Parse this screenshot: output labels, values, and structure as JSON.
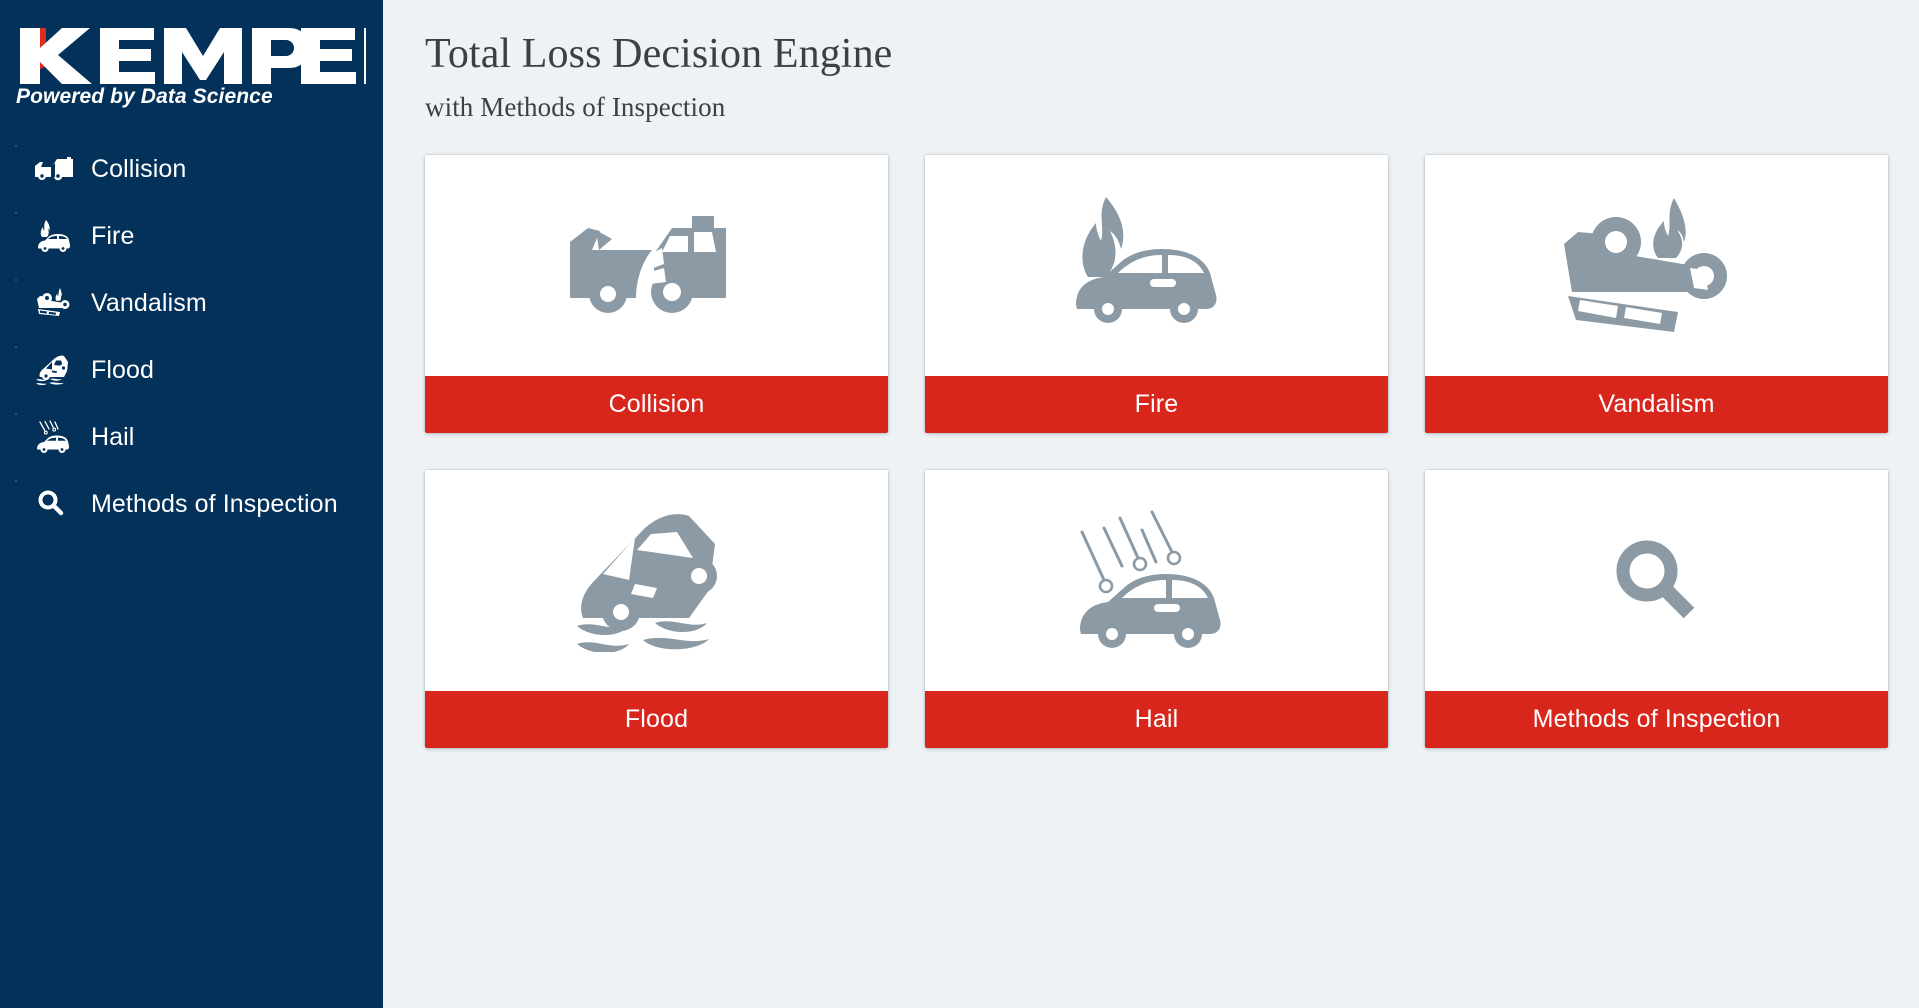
{
  "brand": {
    "logo_text": "KEMPER",
    "tagline": "Powered by Data Science",
    "navy": "#033159",
    "red": "#d9261c",
    "logo_accent_red": "#e02b1b"
  },
  "theme": {
    "page_background": "#eff2f5",
    "card_background": "#ffffff",
    "band_red": "#d9261c",
    "icon_gray": "#8b9aa4",
    "title_color": "#3b4045"
  },
  "sidebar": {
    "items": [
      {
        "label": "Collision",
        "icon": "collision-cars-icon"
      },
      {
        "label": "Fire",
        "icon": "car-fire-icon"
      },
      {
        "label": "Vandalism",
        "icon": "overturned-car-fire-icon"
      },
      {
        "label": "Flood",
        "icon": "car-flood-icon"
      },
      {
        "label": "Hail",
        "icon": "car-hail-icon"
      },
      {
        "label": "Methods of Inspection",
        "icon": "search-icon"
      }
    ]
  },
  "header": {
    "title": "Total Loss Decision Engine",
    "subtitle": "with Methods of Inspection"
  },
  "cards": [
    {
      "label": "Collision",
      "icon": "collision-cars-icon"
    },
    {
      "label": "Fire",
      "icon": "car-fire-icon"
    },
    {
      "label": "Vandalism",
      "icon": "overturned-car-fire-icon"
    },
    {
      "label": "Flood",
      "icon": "car-flood-icon"
    },
    {
      "label": "Hail",
      "icon": "car-hail-icon"
    },
    {
      "label": "Methods of Inspection",
      "icon": "search-icon"
    }
  ]
}
